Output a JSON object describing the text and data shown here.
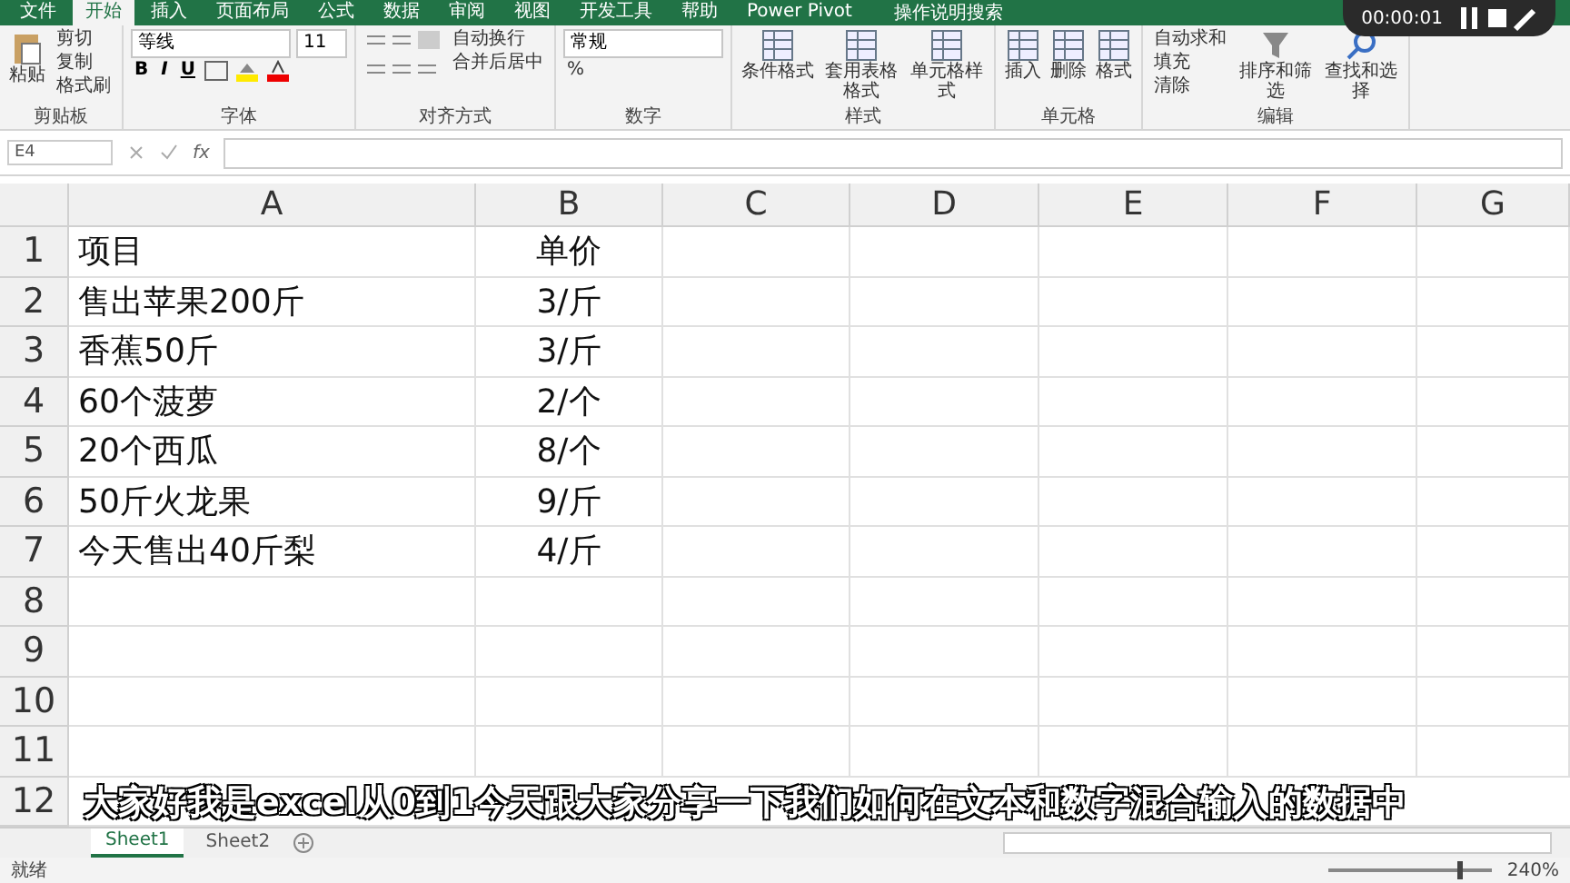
{
  "ribbon_tabs": [
    {
      "label": "文件",
      "selected": false
    },
    {
      "label": "开始",
      "selected": true
    },
    {
      "label": "插入",
      "selected": false
    },
    {
      "label": "页面布局",
      "selected": false
    },
    {
      "label": "公式",
      "selected": false
    },
    {
      "label": "数据",
      "selected": false
    },
    {
      "label": "审阅",
      "selected": false
    },
    {
      "label": "视图",
      "selected": false
    },
    {
      "label": "开发工具",
      "selected": false
    },
    {
      "label": "帮助",
      "selected": false
    },
    {
      "label": "Power Pivot",
      "selected": false
    }
  ],
  "tell_me": "操作说明搜索",
  "ribbon_groups": [
    {
      "kind": "clipboard",
      "label": "剪贴板",
      "large": "粘贴",
      "small": [
        "剪切",
        "复制",
        "格式刷"
      ]
    },
    {
      "kind": "font",
      "label": "字体",
      "font_name": "等线",
      "font_size": "11",
      "styles": [
        "B",
        "I",
        "U"
      ]
    },
    {
      "kind": "alignment",
      "label": "对齐方式",
      "small": [
        "自动换行",
        "合并后居中"
      ]
    },
    {
      "kind": "number",
      "label": "数字",
      "format": "常规",
      "small": [
        "%"
      ]
    },
    {
      "kind": "styles",
      "label": "样式",
      "large_list": [
        "条件格式",
        "套用表格格式",
        "单元格样式"
      ]
    },
    {
      "kind": "cells",
      "label": "单元格",
      "large_list": [
        "插入",
        "删除",
        "格式"
      ]
    },
    {
      "kind": "editing",
      "label": "编辑",
      "small": [
        "自动求和",
        "填充",
        "清除"
      ],
      "large_list": [
        "排序和筛选",
        "查找和选择"
      ]
    }
  ],
  "formula_bar": {
    "name_box": "E4",
    "fx": "fx"
  },
  "columns": [
    "A",
    "B",
    "C",
    "D",
    "E",
    "F",
    "G"
  ],
  "rows": [
    {
      "number": "1",
      "cells": [
        "项目",
        "单价"
      ]
    },
    {
      "number": "2",
      "cells": [
        "售出苹果200斤",
        "3/斤"
      ]
    },
    {
      "number": "3",
      "cells": [
        "香蕉50斤",
        "3/斤"
      ]
    },
    {
      "number": "4",
      "cells": [
        "60个菠萝",
        "2/个"
      ]
    },
    {
      "number": "5",
      "cells": [
        "20个西瓜",
        "8/个"
      ]
    },
    {
      "number": "6",
      "cells": [
        "50斤火龙果",
        "9/斤"
      ]
    },
    {
      "number": "7",
      "cells": [
        "今天售出40斤梨",
        "4/斤"
      ]
    },
    {
      "number": "8",
      "cells": []
    },
    {
      "number": "9",
      "cells": []
    },
    {
      "number": "10",
      "cells": []
    },
    {
      "number": "11",
      "cells": []
    },
    {
      "number": "12",
      "cells": []
    }
  ],
  "sheet_tabs": [
    {
      "label": "Sheet1",
      "selected": true
    },
    {
      "label": "Sheet2",
      "selected": false
    }
  ],
  "status_bar": {
    "status": "就绪",
    "zoom": "240%",
    "zoom_slider": {
      "level": 0.8
    }
  },
  "video_overlay": {
    "time": "00:00:01",
    "subtitle": "大家好我是excel从0到1今天跟大家分享一下我们如何在文本和数字混合输入的数据中"
  }
}
